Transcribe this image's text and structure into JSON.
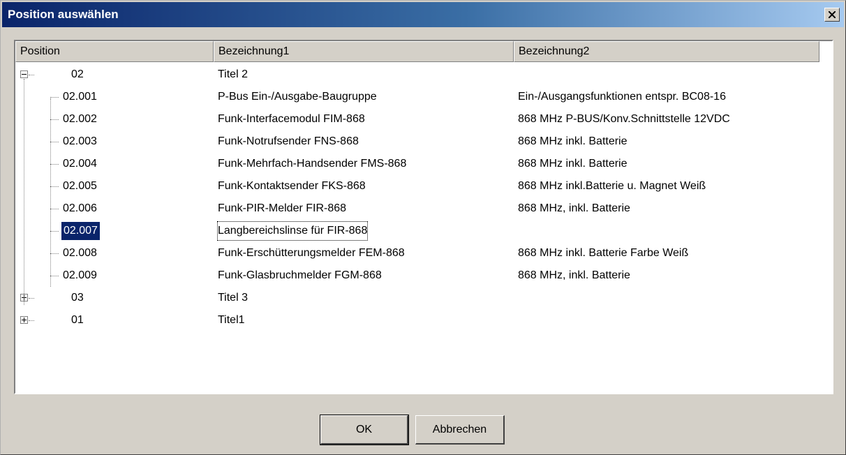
{
  "window": {
    "title": "Position auswählen"
  },
  "columns": [
    "Position",
    "Bezeichnung1",
    "Bezeichnung2"
  ],
  "rows": [
    {
      "pos": "02",
      "b1": "Titel 2",
      "b2": "",
      "level": 0,
      "expander": "minus"
    },
    {
      "pos": "02.001",
      "b1": "P-Bus Ein-/Ausgabe-Baugruppe",
      "b2": "Ein-/Ausgangsfunktionen entspr. BC08-16",
      "level": 1
    },
    {
      "pos": "02.002",
      "b1": "Funk-Interfacemodul FIM-868",
      "b2": "868 MHz P-BUS/Konv.Schnittstelle 12VDC",
      "level": 1
    },
    {
      "pos": "02.003",
      "b1": "Funk-Notrufsender FNS-868",
      "b2": "868 MHz inkl. Batterie",
      "level": 1
    },
    {
      "pos": "02.004",
      "b1": "Funk-Mehrfach-Handsender FMS-868",
      "b2": "868 MHz inkl. Batterie",
      "level": 1
    },
    {
      "pos": "02.005",
      "b1": "Funk-Kontaktsender FKS-868",
      "b2": "868 MHz inkl.Batterie u. Magnet Weiß",
      "level": 1
    },
    {
      "pos": "02.006",
      "b1": "Funk-PIR-Melder FIR-868",
      "b2": "868 MHz, inkl. Batterie",
      "level": 1
    },
    {
      "pos": "02.007",
      "b1": "Langbereichslinse für FIR-868",
      "b2": "",
      "level": 1,
      "selected": true
    },
    {
      "pos": "02.008",
      "b1": "Funk-Erschütterungsmelder FEM-868",
      "b2": "868 MHz inkl. Batterie Farbe Weiß",
      "level": 1
    },
    {
      "pos": "02.009",
      "b1": "Funk-Glasbruchmelder FGM-868",
      "b2": "868 MHz, inkl. Batterie",
      "level": 1
    },
    {
      "pos": "03",
      "b1": "Titel 3",
      "b2": "",
      "level": 0,
      "expander": "plus"
    },
    {
      "pos": "01",
      "b1": "Titel1",
      "b2": "",
      "level": 0,
      "expander": "plus"
    }
  ],
  "buttons": {
    "ok": "OK",
    "cancel": "Abbrechen"
  },
  "colors": {
    "selection": "#0a246a",
    "title_gradient_start": "#0a246a",
    "title_gradient_end": "#a6caf0",
    "face": "#d4d0c8"
  }
}
